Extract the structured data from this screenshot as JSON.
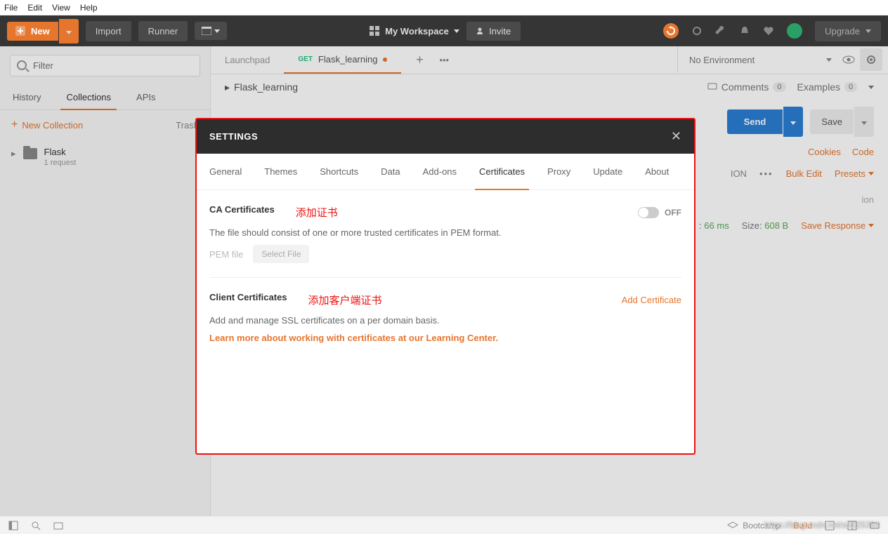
{
  "menu": {
    "items": [
      "File",
      "Edit",
      "View",
      "Help"
    ]
  },
  "toolbar": {
    "new": "New",
    "import": "Import",
    "runner": "Runner",
    "workspace": "My Workspace",
    "invite": "Invite",
    "upgrade": "Upgrade"
  },
  "sidebar": {
    "filter_placeholder": "Filter",
    "tabs": {
      "history": "History",
      "collections": "Collections",
      "apis": "APIs"
    },
    "new_collection": "New Collection",
    "trash": "Trash",
    "collection": {
      "name": "Flask",
      "sub": "1 request"
    }
  },
  "main": {
    "tabs": {
      "launchpad": "Launchpad",
      "method": "GET",
      "req_name": "Flask_learning"
    },
    "env": "No Environment",
    "breadcrumb": "Flask_learning",
    "comments": "Comments",
    "comments_count": "0",
    "examples": "Examples",
    "examples_count": "0",
    "send": "Send",
    "save": "Save",
    "cookies": "Cookies",
    "code": "Code",
    "bulk_edit": "Bulk Edit",
    "presets": "Presets",
    "ion1": "ION",
    "ion2": "ion",
    "time_label": "66 ms",
    "time_prefix": ":",
    "size_label": "Size:",
    "size_val": "608 B",
    "save_response": "Save Response"
  },
  "modal": {
    "title": "SETTINGS",
    "tabs": [
      "General",
      "Themes",
      "Shortcuts",
      "Data",
      "Add-ons",
      "Certificates",
      "Proxy",
      "Update",
      "About"
    ],
    "active_tab": 5,
    "ca_title": "CA Certificates",
    "ca_anno": "添加证书",
    "toggle_state": "OFF",
    "ca_desc": "The file should consist of one or more trusted certificates in PEM format.",
    "pem_label": "PEM file",
    "select_file": "Select File",
    "client_title": "Client Certificates",
    "client_anno": "添加客户端证书",
    "add_cert": "Add Certificate",
    "client_desc": "Add and manage SSL certificates on a per domain basis.",
    "learn": "Learn more about working with certificates at our Learning Center."
  },
  "statusbar": {
    "bootcamp": "Bootcamp",
    "build": "Build"
  },
  "watermark": "https://blog.csdn.net/a5225354"
}
